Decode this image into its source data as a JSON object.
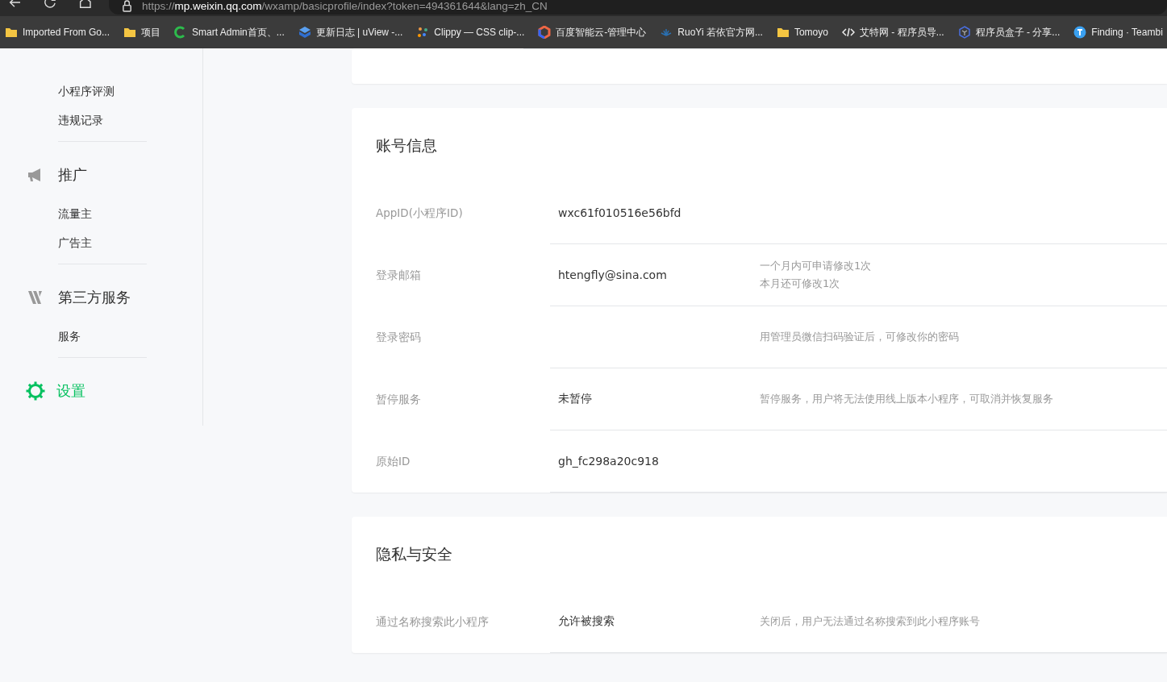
{
  "browser": {
    "url_scheme": "https://",
    "url_host": "mp.weixin.qq.com",
    "url_path": "/wxamp/basicprofile/index?token=494361644&lang=zh_CN",
    "bookmarks": [
      {
        "kind": "folder",
        "label": "Imported From Go..."
      },
      {
        "kind": "folder",
        "label": "项目"
      },
      {
        "kind": "letter",
        "label": "Smart Admin首页、..."
      },
      {
        "kind": "cube",
        "label": "更新日志 | uView -..."
      },
      {
        "kind": "dots",
        "label": "Clippy — CSS clip-..."
      },
      {
        "kind": "hex",
        "label": "百度智能云-管理中心"
      },
      {
        "kind": "lotus",
        "label": "RuoYi 若依官方网..."
      },
      {
        "kind": "folder",
        "label": "Tomoyo"
      },
      {
        "kind": "code",
        "label": "艾特网 - 程序员导..."
      },
      {
        "kind": "box",
        "label": "程序员盒子 - 分享..."
      },
      {
        "kind": "circle",
        "label": "Finding · Teambi"
      }
    ]
  },
  "sidebar": {
    "groups": [
      {
        "kind": "list",
        "items": [
          "小程序评测",
          "违规记录"
        ]
      },
      {
        "kind": "megaphone",
        "title": "推广",
        "selected": false,
        "items": [
          "流量主",
          "广告主"
        ]
      },
      {
        "kind": "mark",
        "title": "第三方服务",
        "selected": false,
        "items": [
          "服务"
        ]
      },
      {
        "kind": "gear",
        "title": "设置",
        "selected": true
      }
    ]
  },
  "sections": [
    {
      "title": "账号信息",
      "rows": [
        {
          "label": "AppID(小程序ID)",
          "value": "wxc61f010516e56bfd"
        },
        {
          "label": "登录邮箱",
          "value": "htengfly@sina.com",
          "notes": [
            "一个月内可申请修改1次",
            "本月还可修改1次"
          ]
        },
        {
          "label": "登录密码",
          "notes": [
            "用管理员微信扫码验证后，可修改你的密码"
          ]
        },
        {
          "label": "暂停服务",
          "value": "未暂停",
          "notes": [
            "暂停服务，用户将无法使用线上版本小程序，可取消并恢复服务"
          ]
        },
        {
          "label": "原始ID",
          "value": "gh_fc298a20c918"
        }
      ]
    },
    {
      "title": "隐私与安全",
      "rows": [
        {
          "label": "通过名称搜索此小程序",
          "value": "允许被搜索",
          "notes": [
            "关闭后，用户无法通过名称搜索到此小程序账号"
          ]
        }
      ]
    }
  ]
}
